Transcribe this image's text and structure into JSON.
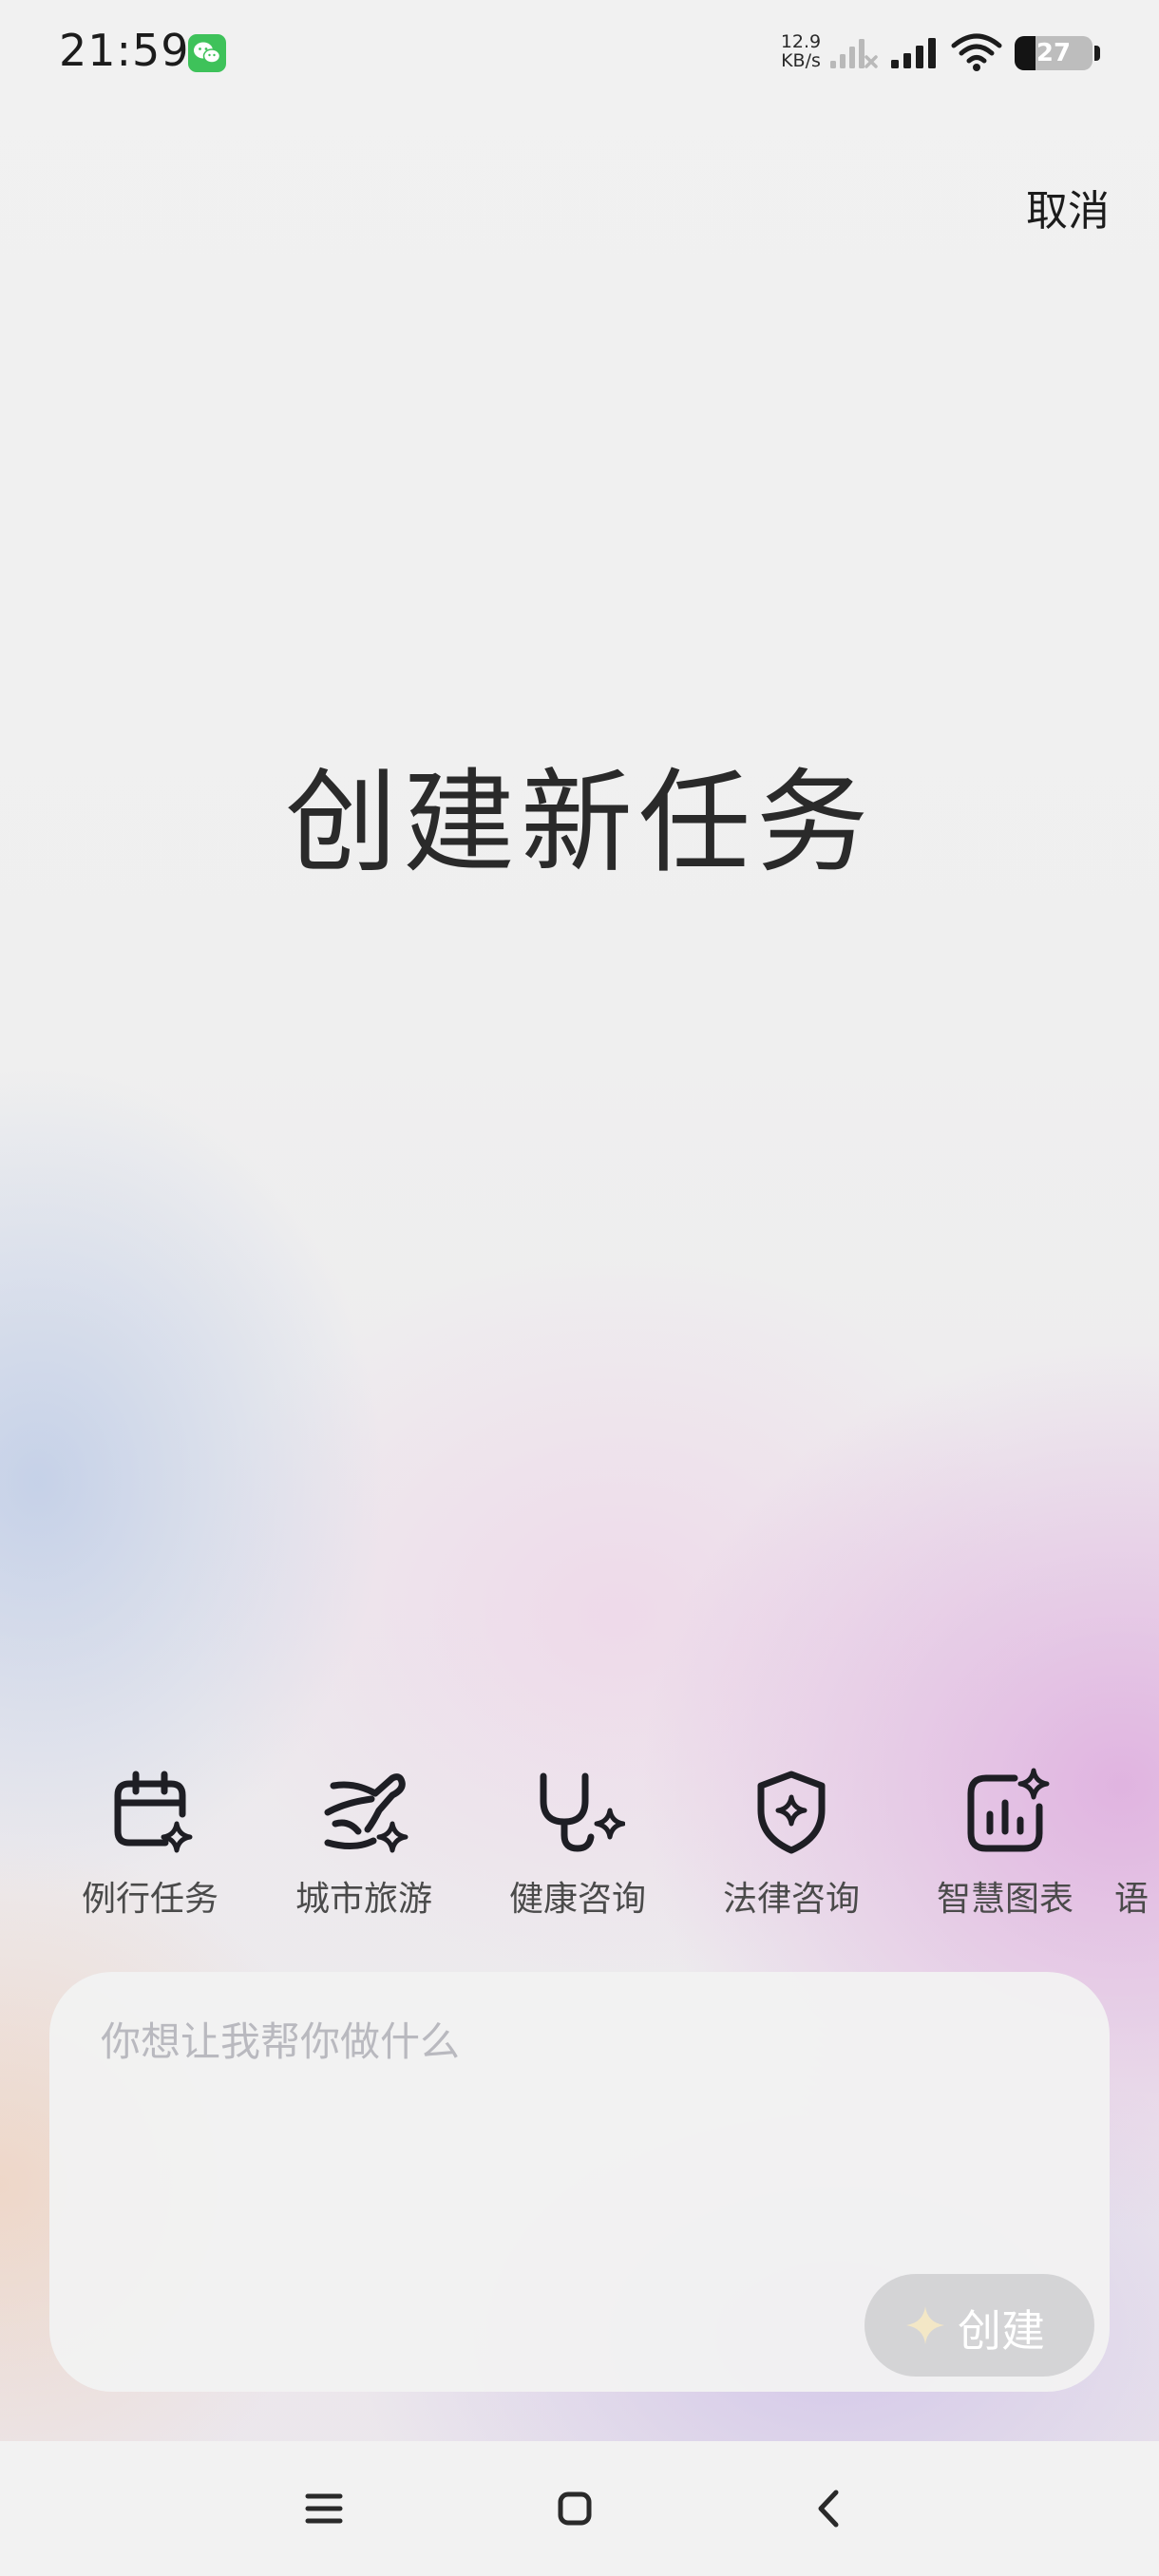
{
  "status_bar": {
    "time": "21:59",
    "app_icon": "wechat-icon",
    "net_speed_value": "12.9",
    "net_speed_unit": "KB/s",
    "battery_level": "27",
    "battery_fraction": 0.27,
    "icons": [
      "sim-signal-off-icon",
      "cell-signal-icon",
      "wifi-icon",
      "battery-icon"
    ]
  },
  "header": {
    "cancel_label": "取消"
  },
  "main": {
    "title": "创建新任务"
  },
  "categories": [
    {
      "label": "例行任务",
      "icon": "calendar-sparkle-icon"
    },
    {
      "label": "城市旅游",
      "icon": "plane-sparkle-icon"
    },
    {
      "label": "健康咨询",
      "icon": "stethoscope-sparkle-icon"
    },
    {
      "label": "法律咨询",
      "icon": "shield-sparkle-icon"
    },
    {
      "label": "智慧图表",
      "icon": "chart-sparkle-icon"
    },
    {
      "label": "语",
      "icon": ""
    }
  ],
  "composer": {
    "placeholder": "你想让我帮你做什么",
    "create_label": "创建",
    "create_icon": "sparkle-icon"
  },
  "nav_bar": {
    "icons": [
      "menu-icon",
      "home-icon",
      "back-icon"
    ]
  },
  "colors": {
    "icon_stroke": "#1e1e24",
    "create_button_bg": "#d4d4d6",
    "sparkle": "#f3e7c6",
    "placeholder": "#b9b9bf"
  }
}
